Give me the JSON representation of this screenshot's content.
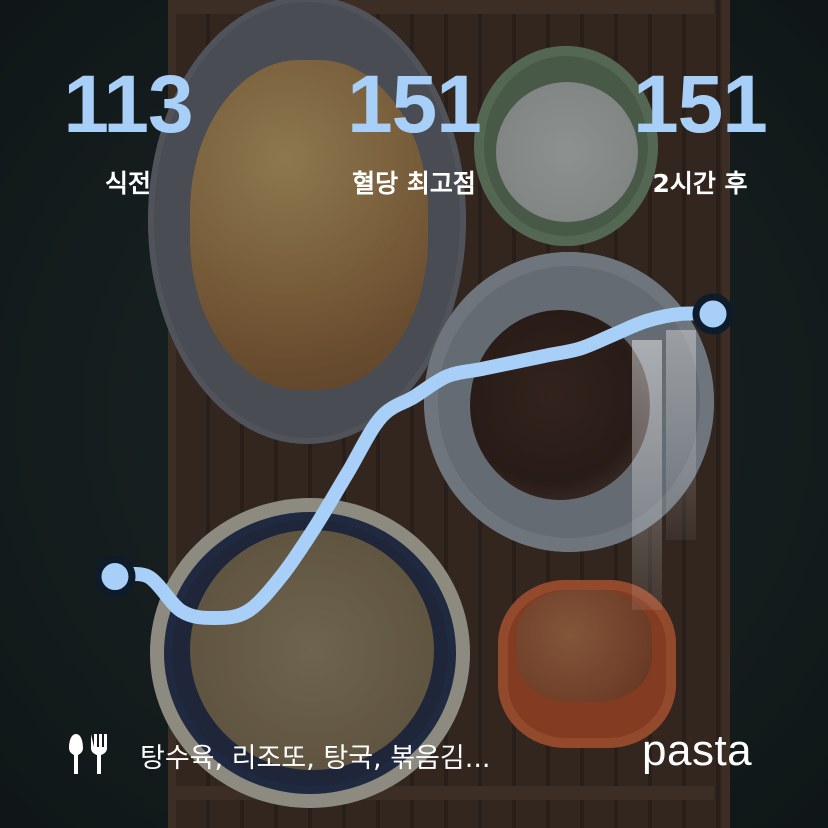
{
  "stats": [
    {
      "value": "113",
      "label": "식전"
    },
    {
      "value": "151",
      "label": "혈당 최고점"
    },
    {
      "value": "151",
      "label": "2시간 후"
    }
  ],
  "chart_data": {
    "type": "line",
    "series": [
      {
        "values": [
          113,
          113,
          108,
          107,
          108,
          113,
          120,
          128,
          136,
          139,
          142,
          143,
          144,
          145,
          146,
          148,
          150,
          151,
          151
        ]
      }
    ],
    "start_value": 113,
    "end_value": 151,
    "color": "#a8cff7"
  },
  "footer": {
    "menu_text": "탕수육, 리조또, 탕국, 볶음김...",
    "brand": "pasta"
  },
  "colors": {
    "accent": "#a8cff7",
    "text": "#ffffff",
    "marker_outline": "#0d1b2a"
  },
  "icons": {
    "footer": "fork-knife-icon"
  }
}
